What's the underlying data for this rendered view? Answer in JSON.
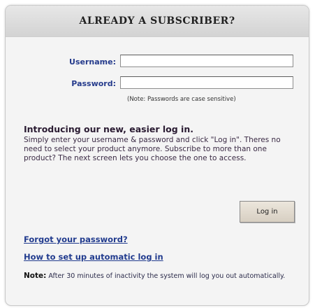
{
  "header": {
    "title": "ALREADY A SUBSCRIBER?"
  },
  "form": {
    "username_label": "Username:",
    "username_value": "",
    "password_label": "Password:",
    "password_value": "",
    "password_note": "(Note: Passwords are case sensitive)"
  },
  "intro": {
    "heading": "Introducing our new, easier log in.",
    "body": "Simply enter your username & password and click \"Log in\". Theres no need to select your product anymore. Subscribe to more than one product? The next screen lets you choose the one to access."
  },
  "actions": {
    "login_label": "Log in"
  },
  "links": {
    "forgot_password": "Forgot your password?",
    "auto_login": "How to set up automatic log in"
  },
  "footer": {
    "note_label": "Note:",
    "note_text": "After 30 minutes of inactivity the system will log you out automatically."
  }
}
